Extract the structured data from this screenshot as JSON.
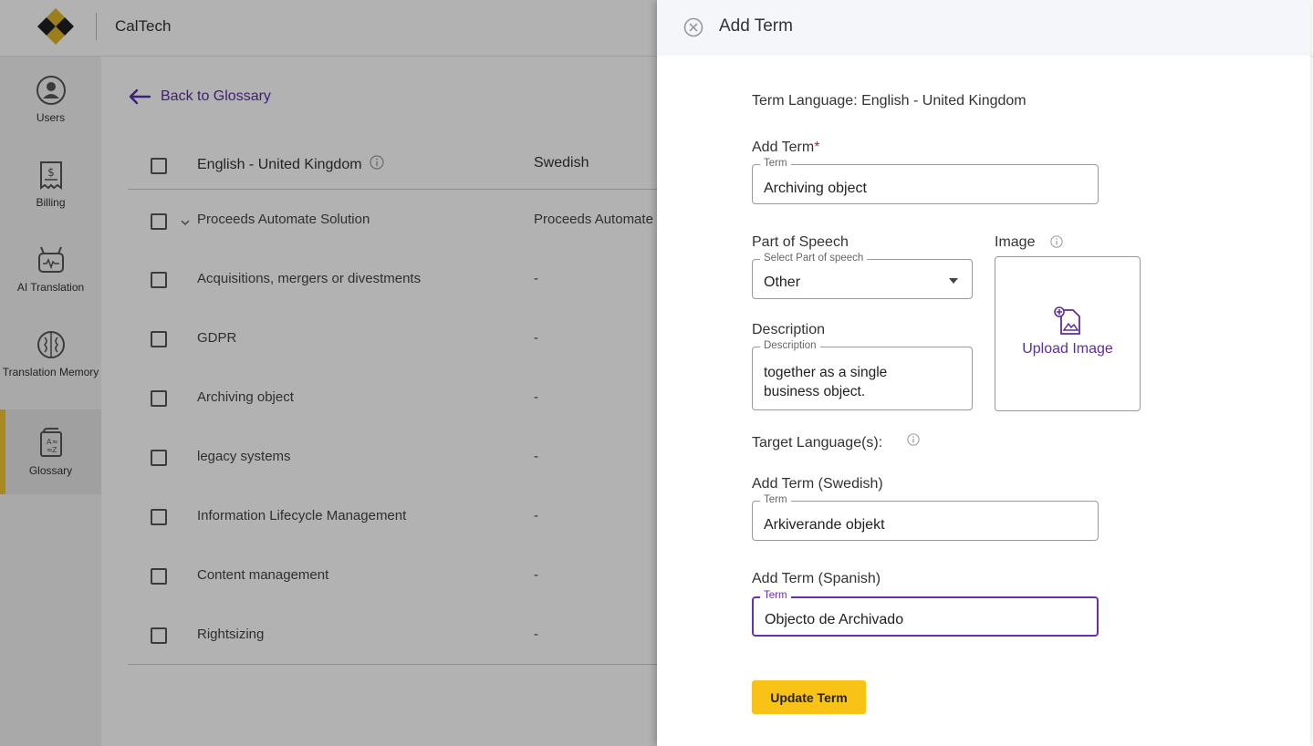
{
  "app": {
    "name": "CalTech"
  },
  "sidebar": {
    "items": [
      {
        "label": "Users",
        "icon": "user-circle-icon"
      },
      {
        "label": "Billing",
        "icon": "billing-icon"
      },
      {
        "label": "AI Translation",
        "icon": "robot-icon"
      },
      {
        "label": "Translation Memory",
        "icon": "brain-icon"
      },
      {
        "label": "Glossary",
        "icon": "glossary-icon",
        "active": true
      }
    ]
  },
  "main": {
    "back_label": "Back to Glossary",
    "columns": [
      "English - United Kingdom",
      "Swedish"
    ],
    "rows": [
      {
        "english": "Proceeds Automate Solution",
        "swedish": "Proceeds Automate"
      },
      {
        "english": "Acquisitions, mergers or divestments",
        "swedish": "-"
      },
      {
        "english": "GDPR",
        "swedish": "-"
      },
      {
        "english": "Archiving object",
        "swedish": "-"
      },
      {
        "english": "legacy systems",
        "swedish": "-"
      },
      {
        "english": "Information Lifecycle Management",
        "swedish": "-"
      },
      {
        "english": "Content management",
        "swedish": "-"
      },
      {
        "english": "Rightsizing",
        "swedish": "-"
      }
    ]
  },
  "panel": {
    "title": "Add Term",
    "term_language": "Term Language: English - United Kingdom",
    "add_term_label": "Add Term",
    "required_mark": "*",
    "term_legend": "Term",
    "term_value": "Archiving object",
    "pos_label": "Part of Speech",
    "pos_legend": "Select Part of speech",
    "pos_value": "Other",
    "image_label": "Image",
    "upload_label": "Upload Image",
    "description_label": "Description",
    "description_legend": "Description",
    "description_value": "together as a single\nbusiness object.",
    "target_label": "Target Language(s):",
    "swedish_label": "Add Term (Swedish)",
    "swedish_legend": "Term",
    "swedish_value": "Arkiverande objekt",
    "spanish_label": "Add Term (Spanish)",
    "spanish_legend": "Term",
    "spanish_value": "Objecto de Archivado",
    "submit_label": "Update Term"
  },
  "colors": {
    "accent": "#5a2ea6",
    "brand_yellow": "#f8c316",
    "focus": "#6a2fae"
  }
}
